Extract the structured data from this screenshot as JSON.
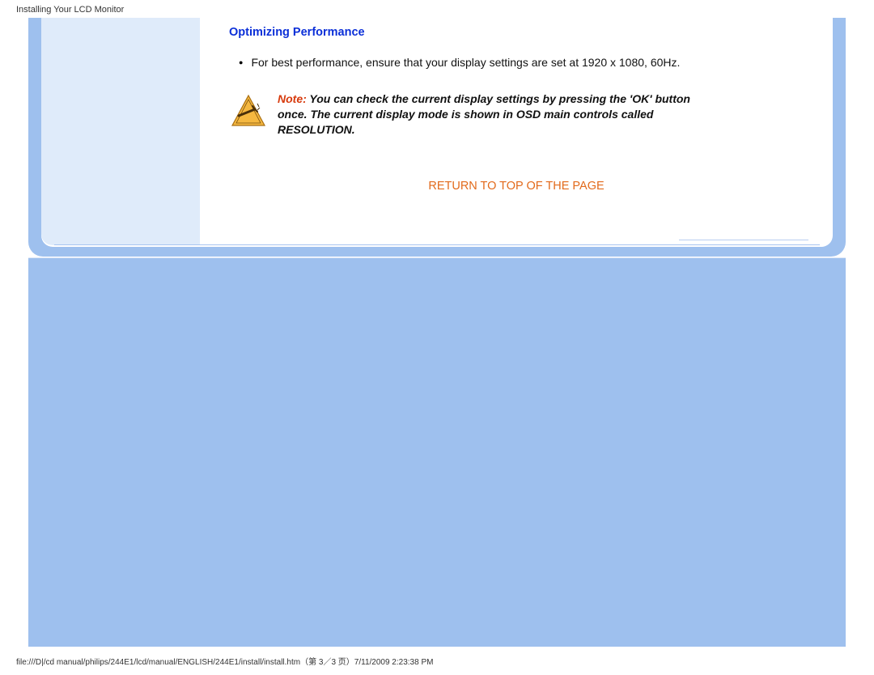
{
  "header": {
    "page_title": "Installing Your LCD Monitor"
  },
  "content": {
    "heading": "Optimizing Performance",
    "bullet1": "For best performance, ensure that your display settings are set at 1920 x 1080, 60Hz.",
    "note_label": "Note:",
    "note_body": " You can check the current display settings by pressing the 'OK' button once. The current display mode is shown in OSD main controls called RESOLUTION.",
    "return_link": "RETURN TO TOP OF THE PAGE"
  },
  "footer": {
    "path": "file:///D|/cd manual/philips/244E1/lcd/manual/ENGLISH/244E1/install/install.htm（第 3／3 页）7/11/2009 2:23:38 PM"
  },
  "icons": {
    "warning": "warning-triangle-icon"
  }
}
